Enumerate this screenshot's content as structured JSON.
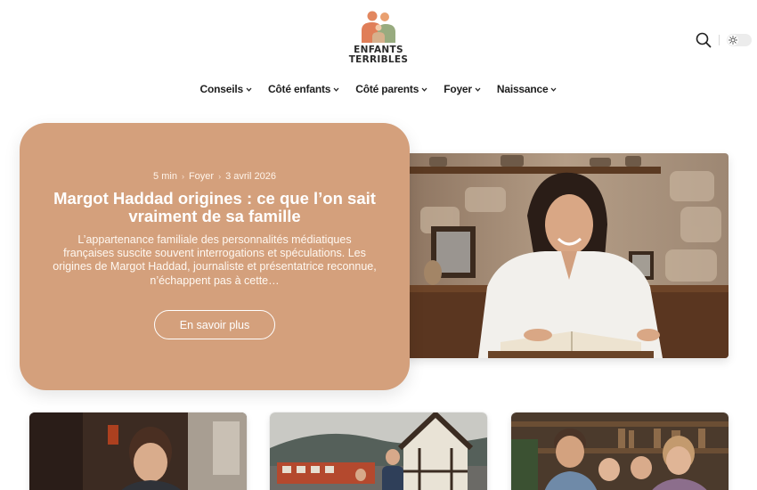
{
  "brand": {
    "line1": "ENFANTS",
    "line2": "TERRIBLES",
    "colors": {
      "orange": "#e2875f",
      "sage": "#98ab7f",
      "tan": "#cfa27e",
      "text": "#2b2b2b"
    }
  },
  "header": {
    "search_icon": "search-icon",
    "theme_icon": "sun-icon"
  },
  "nav": [
    {
      "label": "Conseils"
    },
    {
      "label": "Côté enfants"
    },
    {
      "label": "Côté parents"
    },
    {
      "label": "Foyer"
    },
    {
      "label": "Naissance"
    }
  ],
  "hero": {
    "read_time": "5 min",
    "category": "Foyer",
    "date": "3 avril 2026",
    "title": "Margot Haddad origines : ce que l’on sait vraiment de sa famille",
    "excerpt": "L’appartenance familiale des personnalités médiatiques françaises suscite souvent interrogations et spéculations. Les origines de Margot Haddad, journaliste et présentatrice reconnue, n’échappent pas à cette…",
    "button": "En savoir plus",
    "card_color": "#d4a07c"
  }
}
